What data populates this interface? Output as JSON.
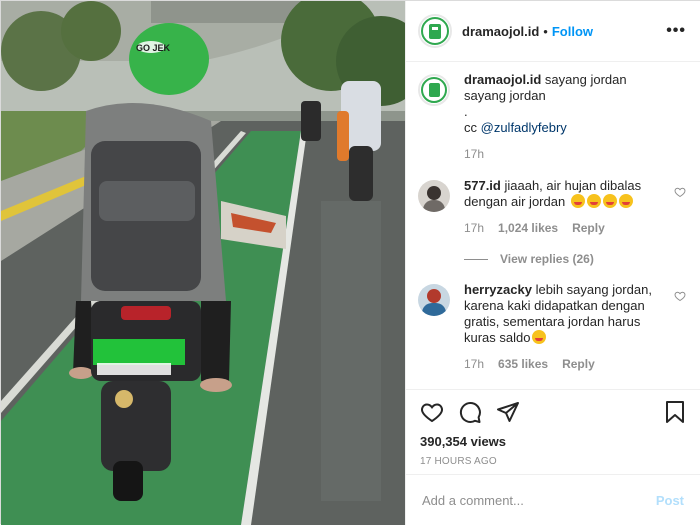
{
  "header": {
    "username": "dramaojol.id",
    "dot": "•",
    "follow_label": "Follow",
    "more_label": "•••"
  },
  "caption": {
    "username": "dramaojol.id",
    "text": "sayang jordan sayang jordan",
    "dot_line": ".",
    "cc_prefix": "cc ",
    "mention": "@zulfadlyfebry",
    "time": "17h"
  },
  "comments": [
    {
      "username": "577.id",
      "text": "jiaaah, air hujan dibalas dengan air jordan",
      "emoji_count": 4,
      "time": "17h",
      "likes": "1,024 likes",
      "reply_label": "Reply",
      "view_replies": "View replies (26)"
    },
    {
      "username": "herryzacky",
      "text": "lebih sayang jordan, karena kaki didapatkan dengan gratis, sementara jordan harus kuras saldo",
      "time": "17h",
      "likes": "635 likes",
      "reply_label": "Reply"
    }
  ],
  "stats": {
    "views": "390,354 views",
    "ago": "17 HOURS AGO"
  },
  "add_comment": {
    "placeholder": "Add a comment...",
    "post_label": "Post"
  },
  "media": {
    "helmet_text": "GO JEK"
  },
  "colors": {
    "follow": "#0095f6",
    "brand_green": "#2fa84f",
    "post_disabled": "#b2dffc"
  }
}
